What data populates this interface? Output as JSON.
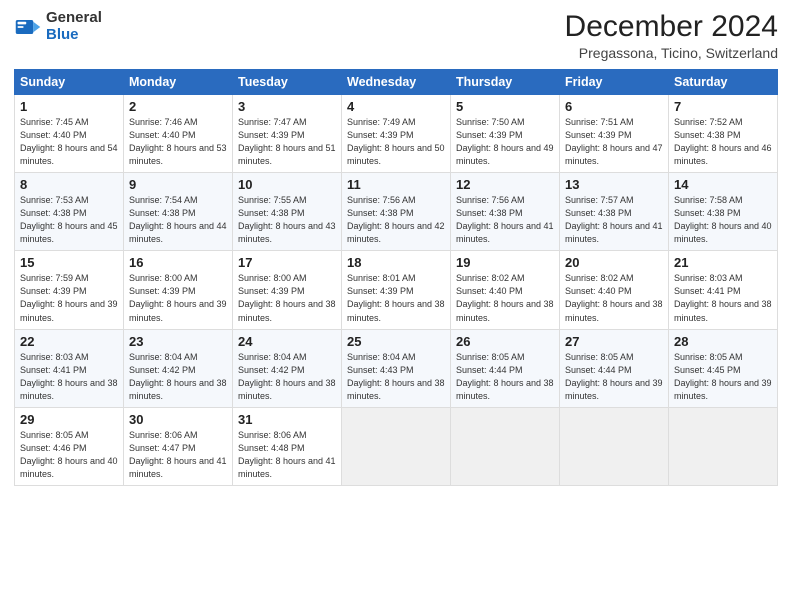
{
  "logo": {
    "general": "General",
    "blue": "Blue"
  },
  "header": {
    "month": "December 2024",
    "location": "Pregassona, Ticino, Switzerland"
  },
  "days_of_week": [
    "Sunday",
    "Monday",
    "Tuesday",
    "Wednesday",
    "Thursday",
    "Friday",
    "Saturday"
  ],
  "weeks": [
    [
      {
        "day": 1,
        "sunrise": "7:45 AM",
        "sunset": "4:40 PM",
        "daylight": "8 hours and 54 minutes."
      },
      {
        "day": 2,
        "sunrise": "7:46 AM",
        "sunset": "4:40 PM",
        "daylight": "8 hours and 53 minutes."
      },
      {
        "day": 3,
        "sunrise": "7:47 AM",
        "sunset": "4:39 PM",
        "daylight": "8 hours and 51 minutes."
      },
      {
        "day": 4,
        "sunrise": "7:49 AM",
        "sunset": "4:39 PM",
        "daylight": "8 hours and 50 minutes."
      },
      {
        "day": 5,
        "sunrise": "7:50 AM",
        "sunset": "4:39 PM",
        "daylight": "8 hours and 49 minutes."
      },
      {
        "day": 6,
        "sunrise": "7:51 AM",
        "sunset": "4:39 PM",
        "daylight": "8 hours and 47 minutes."
      },
      {
        "day": 7,
        "sunrise": "7:52 AM",
        "sunset": "4:38 PM",
        "daylight": "8 hours and 46 minutes."
      }
    ],
    [
      {
        "day": 8,
        "sunrise": "7:53 AM",
        "sunset": "4:38 PM",
        "daylight": "8 hours and 45 minutes."
      },
      {
        "day": 9,
        "sunrise": "7:54 AM",
        "sunset": "4:38 PM",
        "daylight": "8 hours and 44 minutes."
      },
      {
        "day": 10,
        "sunrise": "7:55 AM",
        "sunset": "4:38 PM",
        "daylight": "8 hours and 43 minutes."
      },
      {
        "day": 11,
        "sunrise": "7:56 AM",
        "sunset": "4:38 PM",
        "daylight": "8 hours and 42 minutes."
      },
      {
        "day": 12,
        "sunrise": "7:56 AM",
        "sunset": "4:38 PM",
        "daylight": "8 hours and 41 minutes."
      },
      {
        "day": 13,
        "sunrise": "7:57 AM",
        "sunset": "4:38 PM",
        "daylight": "8 hours and 41 minutes."
      },
      {
        "day": 14,
        "sunrise": "7:58 AM",
        "sunset": "4:38 PM",
        "daylight": "8 hours and 40 minutes."
      }
    ],
    [
      {
        "day": 15,
        "sunrise": "7:59 AM",
        "sunset": "4:39 PM",
        "daylight": "8 hours and 39 minutes."
      },
      {
        "day": 16,
        "sunrise": "8:00 AM",
        "sunset": "4:39 PM",
        "daylight": "8 hours and 39 minutes."
      },
      {
        "day": 17,
        "sunrise": "8:00 AM",
        "sunset": "4:39 PM",
        "daylight": "8 hours and 38 minutes."
      },
      {
        "day": 18,
        "sunrise": "8:01 AM",
        "sunset": "4:39 PM",
        "daylight": "8 hours and 38 minutes."
      },
      {
        "day": 19,
        "sunrise": "8:02 AM",
        "sunset": "4:40 PM",
        "daylight": "8 hours and 38 minutes."
      },
      {
        "day": 20,
        "sunrise": "8:02 AM",
        "sunset": "4:40 PM",
        "daylight": "8 hours and 38 minutes."
      },
      {
        "day": 21,
        "sunrise": "8:03 AM",
        "sunset": "4:41 PM",
        "daylight": "8 hours and 38 minutes."
      }
    ],
    [
      {
        "day": 22,
        "sunrise": "8:03 AM",
        "sunset": "4:41 PM",
        "daylight": "8 hours and 38 minutes."
      },
      {
        "day": 23,
        "sunrise": "8:04 AM",
        "sunset": "4:42 PM",
        "daylight": "8 hours and 38 minutes."
      },
      {
        "day": 24,
        "sunrise": "8:04 AM",
        "sunset": "4:42 PM",
        "daylight": "8 hours and 38 minutes."
      },
      {
        "day": 25,
        "sunrise": "8:04 AM",
        "sunset": "4:43 PM",
        "daylight": "8 hours and 38 minutes."
      },
      {
        "day": 26,
        "sunrise": "8:05 AM",
        "sunset": "4:44 PM",
        "daylight": "8 hours and 38 minutes."
      },
      {
        "day": 27,
        "sunrise": "8:05 AM",
        "sunset": "4:44 PM",
        "daylight": "8 hours and 39 minutes."
      },
      {
        "day": 28,
        "sunrise": "8:05 AM",
        "sunset": "4:45 PM",
        "daylight": "8 hours and 39 minutes."
      }
    ],
    [
      {
        "day": 29,
        "sunrise": "8:05 AM",
        "sunset": "4:46 PM",
        "daylight": "8 hours and 40 minutes."
      },
      {
        "day": 30,
        "sunrise": "8:06 AM",
        "sunset": "4:47 PM",
        "daylight": "8 hours and 41 minutes."
      },
      {
        "day": 31,
        "sunrise": "8:06 AM",
        "sunset": "4:48 PM",
        "daylight": "8 hours and 41 minutes."
      },
      null,
      null,
      null,
      null
    ]
  ],
  "labels": {
    "sunrise": "Sunrise:",
    "sunset": "Sunset:",
    "daylight": "Daylight:"
  }
}
